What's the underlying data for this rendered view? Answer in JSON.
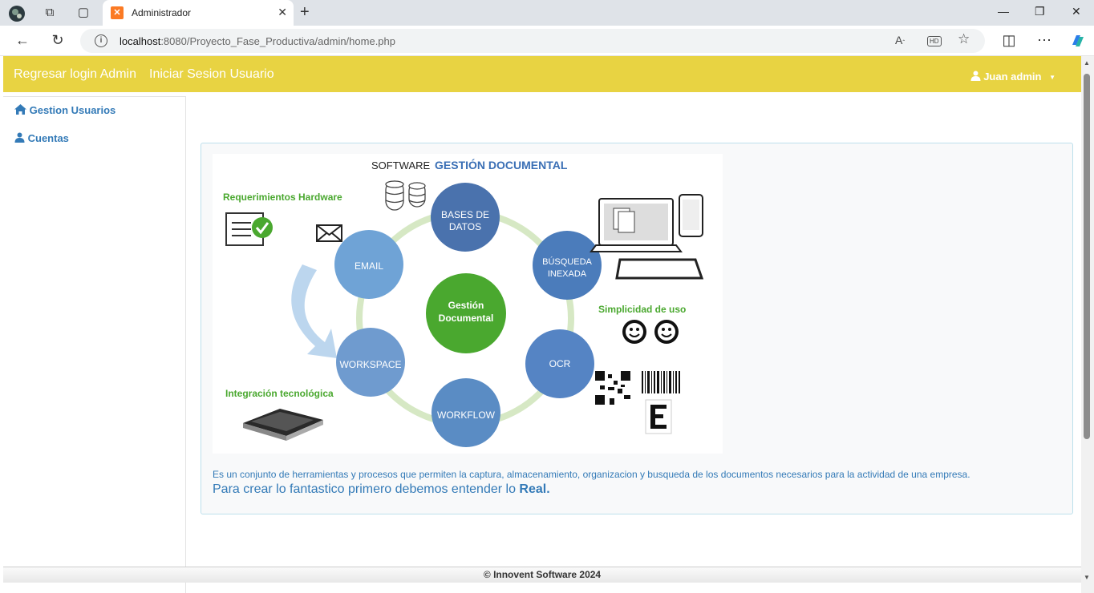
{
  "browser": {
    "tab_title": "Administrador",
    "url_host": "localhost",
    "url_path": ":8080/Proyecto_Fase_Productiva/admin/home.php"
  },
  "navbar": {
    "link_regresar": "Regresar login Admin",
    "link_iniciar": "Iniciar Sesion Usuario",
    "user_name": "Juan admin"
  },
  "sidebar": {
    "items": [
      {
        "label": "Gestion Usuarios",
        "icon": "home-icon"
      },
      {
        "label": "Cuentas",
        "icon": "user-icon"
      }
    ]
  },
  "diagram": {
    "title_prefix": "SOFTWARE",
    "title_main": "GESTIÓN DOCUMENTAL",
    "center": [
      "Gestión",
      "Documental"
    ],
    "nodes": [
      [
        "BASES DE",
        "DATOS"
      ],
      [
        "BÚSQUEDA",
        "INEXADA"
      ],
      [
        "OCR"
      ],
      [
        "WORKFLOW"
      ],
      [
        "WORKSPACE"
      ],
      [
        "EMAIL"
      ]
    ],
    "label_hardware": "Requerimientos Hardware",
    "label_simplicidad": "Simplicidad de uso",
    "label_integracion": "Integración tecnológica"
  },
  "content": {
    "description": "Es un conjunto de herramientas y procesos que permiten la captura, almacenamiento, organizacion y busqueda de los documentos necesarios para la actividad de una empresa.",
    "quote_prefix": "Para crear lo fantastico primero debemos entender lo ",
    "quote_bold": "Real."
  },
  "footer": {
    "text": "© Innovent Software 2024"
  },
  "colors": {
    "navbar": "#e8d342",
    "link": "#337ab7",
    "node_blue": "#5a8cc4",
    "center_green": "#4aa82f"
  }
}
